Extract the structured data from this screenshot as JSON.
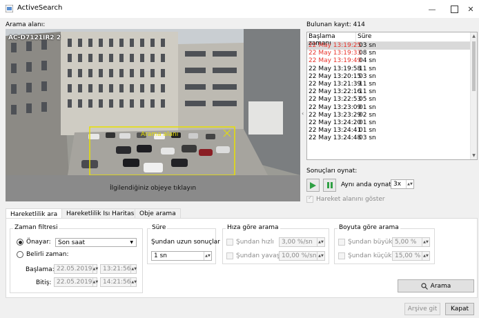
{
  "window": {
    "title": "ActiveSearch"
  },
  "search_area": {
    "label": "Arama alanı:",
    "camera_label": "AC-D7121IR2 2",
    "zone_label": "Arama alanı",
    "hint": "İlgilendiğiniz objeye tıklayın"
  },
  "results": {
    "count_label": "Bulunan kayıt: 414",
    "col_start": "Başlama zamanı",
    "col_duration": "Süre",
    "rows": [
      {
        "time": "22 May 13:19:25",
        "dur": "03 sn",
        "red": true,
        "selected": true
      },
      {
        "time": "22 May 13:19:33",
        "dur": "08 sn",
        "red": true
      },
      {
        "time": "22 May 13:19:49",
        "dur": "04 sn",
        "red": true
      },
      {
        "time": "22 May 13:19:58",
        "dur": "11 sn"
      },
      {
        "time": "22 May 13:20:15",
        "dur": "03 sn"
      },
      {
        "time": "22 May 13:21:39",
        "dur": "11 sn"
      },
      {
        "time": "22 May 13:22:16",
        "dur": "11 sn"
      },
      {
        "time": "22 May 13:22:53",
        "dur": "05 sn"
      },
      {
        "time": "22 May 13:23:09",
        "dur": "01 sn"
      },
      {
        "time": "22 May 13:23:29",
        "dur": "02 sn"
      },
      {
        "time": "22 May 13:24:20",
        "dur": "01 sn"
      },
      {
        "time": "22 May 13:24:41",
        "dur": "01 sn"
      },
      {
        "time": "22 May 13:24:48",
        "dur": "03 sn"
      }
    ]
  },
  "playback": {
    "label": "Sonuçları oynat:",
    "simultaneous_label": "Aynı anda oynat:",
    "simultaneous_value": "3x",
    "show_motion_label": "Hareket alanını göster"
  },
  "tabs": [
    "Hareketlilik ara",
    "Hareketlilik Isı Haritası",
    "Obje arama"
  ],
  "time_filter": {
    "title": "Zaman filtresi",
    "preset_label": "Önayar:",
    "preset_value": "Son saat",
    "custom_label": "Belirli zaman:",
    "start_label": "Başlama:",
    "start_date": "22.05.2019",
    "start_time": "13:21:56",
    "end_label": "Bitiş:",
    "end_date": "22.05.2019",
    "end_time": "14:21:56"
  },
  "duration": {
    "title": "Süre",
    "longer_label": "Şundan uzun sonuçlar",
    "value": "1 sn"
  },
  "speed": {
    "title": "Hıza göre arama",
    "faster_label": "Şundan hızlı",
    "faster_value": "3,00 %/sn",
    "slower_label": "Şundan yavaş",
    "slower_value": "10,00 %/sn"
  },
  "size": {
    "title": "Boyuta göre arama",
    "bigger_label": "Şundan büyük",
    "bigger_value": "5,00 %",
    "smaller_label": "Şundan küçük",
    "smaller_value": "15,00 %"
  },
  "buttons": {
    "search": "Arama",
    "archive": "Arşive git",
    "close": "Kapat"
  },
  "colors": {
    "red_rows": "#e8322a",
    "zone": "#e8e000",
    "play_green": "#2ea043"
  }
}
